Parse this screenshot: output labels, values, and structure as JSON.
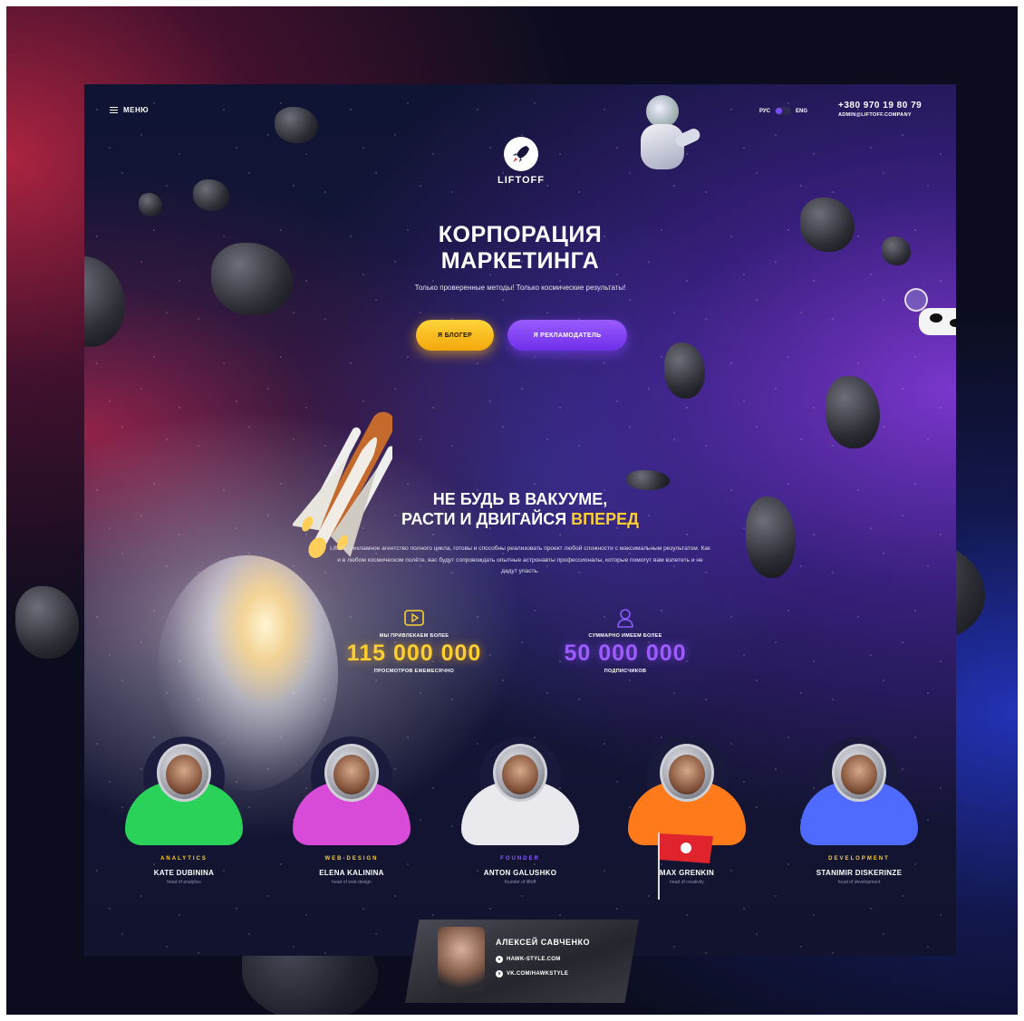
{
  "header": {
    "menu_label": "МЕНЮ",
    "lang_ru": "РУС",
    "lang_en": "ENG",
    "phone": "+380 970 19 80 79",
    "email": "ADMIN@LIFTOFF.COMPANY"
  },
  "logo": {
    "text": "LIFTOFF"
  },
  "hero": {
    "title_line1": "КОРПОРАЦИЯ",
    "title_line2": "МАРКЕТИНГА",
    "subtitle": "Только проверенные методы! Только космические результаты!",
    "btn_blogger": "Я БЛОГЕР",
    "btn_advertiser": "Я РЕКЛАМОДАТЕЛЬ"
  },
  "about": {
    "title_line1": "НЕ БУДЬ В ВАКУУМЕ,",
    "title_line2_prefix": "РАСТИ И ДВИГАЙСЯ ",
    "title_line2_highlight": "ВПЕРЕД",
    "description": "Liftoff - рекламное агентство полного цикла, готовы и способны реализовать проект любой сложности с максимальным результатом. Как и в любом космическом полёте, вас будут сопровождать опытные астронавты профессионалы, которые помогут вам взлететь и не дадут упасть."
  },
  "stats": [
    {
      "label": "МЫ ПРИВЛЕКАЕМ БОЛЕЕ",
      "value": "115 000 000",
      "caption": "ПРОСМОТРОВ ЕЖЕМЕСЯЧНО",
      "icon": "play-icon"
    },
    {
      "label": "СУММАРНО ИМЕЕМ БОЛЕЕ",
      "value": "50 000 000",
      "caption": "ПОДПИСЧИКОВ",
      "icon": "user-icon"
    }
  ],
  "team": [
    {
      "role": "ANALYTICS",
      "name": "KATE DUBININA",
      "title": "head of analytics"
    },
    {
      "role": "WEB-DESIGN",
      "name": "ELENA KALININA",
      "title": "head of web-design"
    },
    {
      "role": "FOUNDER",
      "name": "ANTON GALUSHKO",
      "title": "founder of liftoff"
    },
    {
      "role": "CREATIVITY",
      "name": "MAX GRENKIN",
      "title": "head of creativity"
    },
    {
      "role": "DEVELOPMENT",
      "name": "STANIMIR DISKERINZE",
      "title": "head of development"
    }
  ],
  "author": {
    "name": "АЛЕКСЕЙ САВЧЕНКО",
    "site": "HAWK-STYLE.COM",
    "vk": "VK.COM/HAWKSTYLE"
  },
  "colors": {
    "accent_yellow": "#ffcf2f",
    "accent_purple": "#7b4cff",
    "background": "#12132e"
  }
}
